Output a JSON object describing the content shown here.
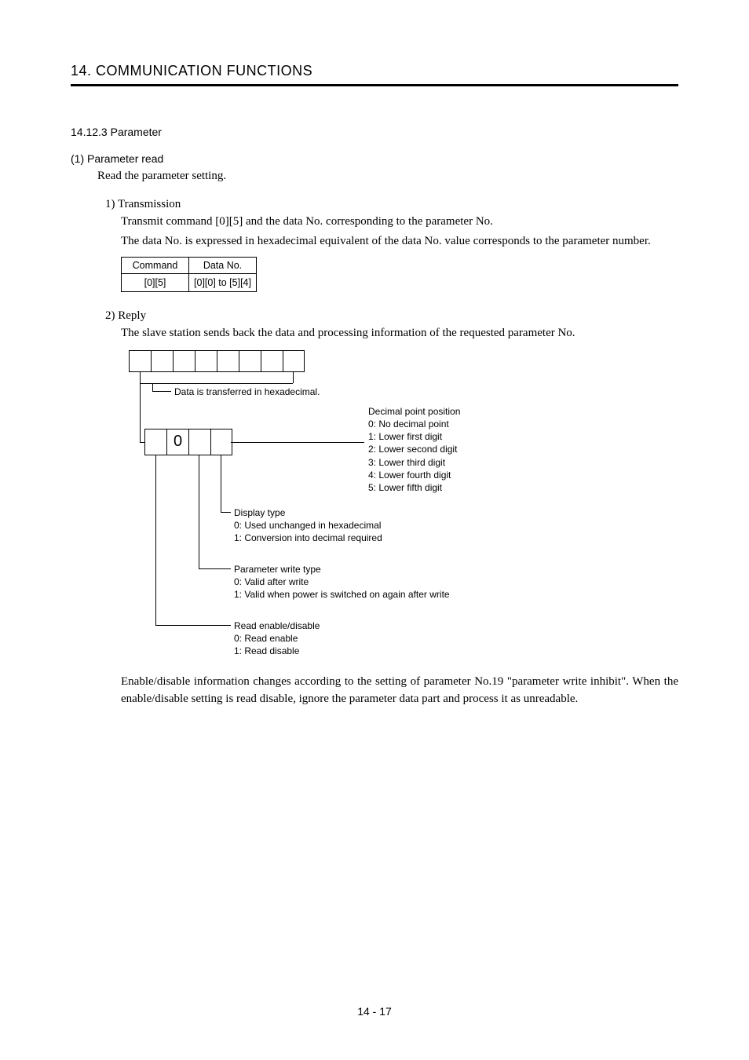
{
  "chapter": "14. COMMUNICATION FUNCTIONS",
  "section": "14.12.3 Parameter",
  "sub1": {
    "title": "(1) Parameter read",
    "intro": "Read the parameter setting.",
    "t1": {
      "title": "1) Transmission",
      "p1": "Transmit command [0][5] and the data No. corresponding to the parameter No.",
      "p2": "The data No. is expressed in hexadecimal equivalent of the data No. value corresponds to the parameter number.",
      "table": {
        "h1": "Command",
        "h2": "Data No.",
        "c1": "[0][5]",
        "c2": "[0][0] to [5][4]"
      }
    },
    "t2": {
      "title": "2) Reply",
      "p1": "The slave station sends back the data and processing information of the requested parameter No.",
      "diag": {
        "zero": "0",
        "dataTransfer": "Data is transferred in hexadecimal.",
        "dpp": {
          "title": "Decimal point position",
          "l0": "0: No decimal point",
          "l1": "1: Lower first digit",
          "l2": "2: Lower second digit",
          "l3": "3: Lower third digit",
          "l4": "4: Lower fourth digit",
          "l5": "5: Lower fifth digit"
        },
        "display": {
          "title": "Display type",
          "l0": "0: Used unchanged in hexadecimal",
          "l1": "1: Conversion into decimal required"
        },
        "pwt": {
          "title": "Parameter write type",
          "l0": "0: Valid after write",
          "l1": "1: Valid when power is switched on again after write"
        },
        "red": {
          "title": "Read enable/disable",
          "l0": "0: Read enable",
          "l1": "1: Read disable"
        }
      },
      "closing": "Enable/disable information changes according to the setting of parameter No.19 \"parameter write inhibit\". When the enable/disable setting is read disable, ignore the parameter data part and process it as unreadable."
    }
  },
  "footer": {
    "page": "14 -  17"
  }
}
